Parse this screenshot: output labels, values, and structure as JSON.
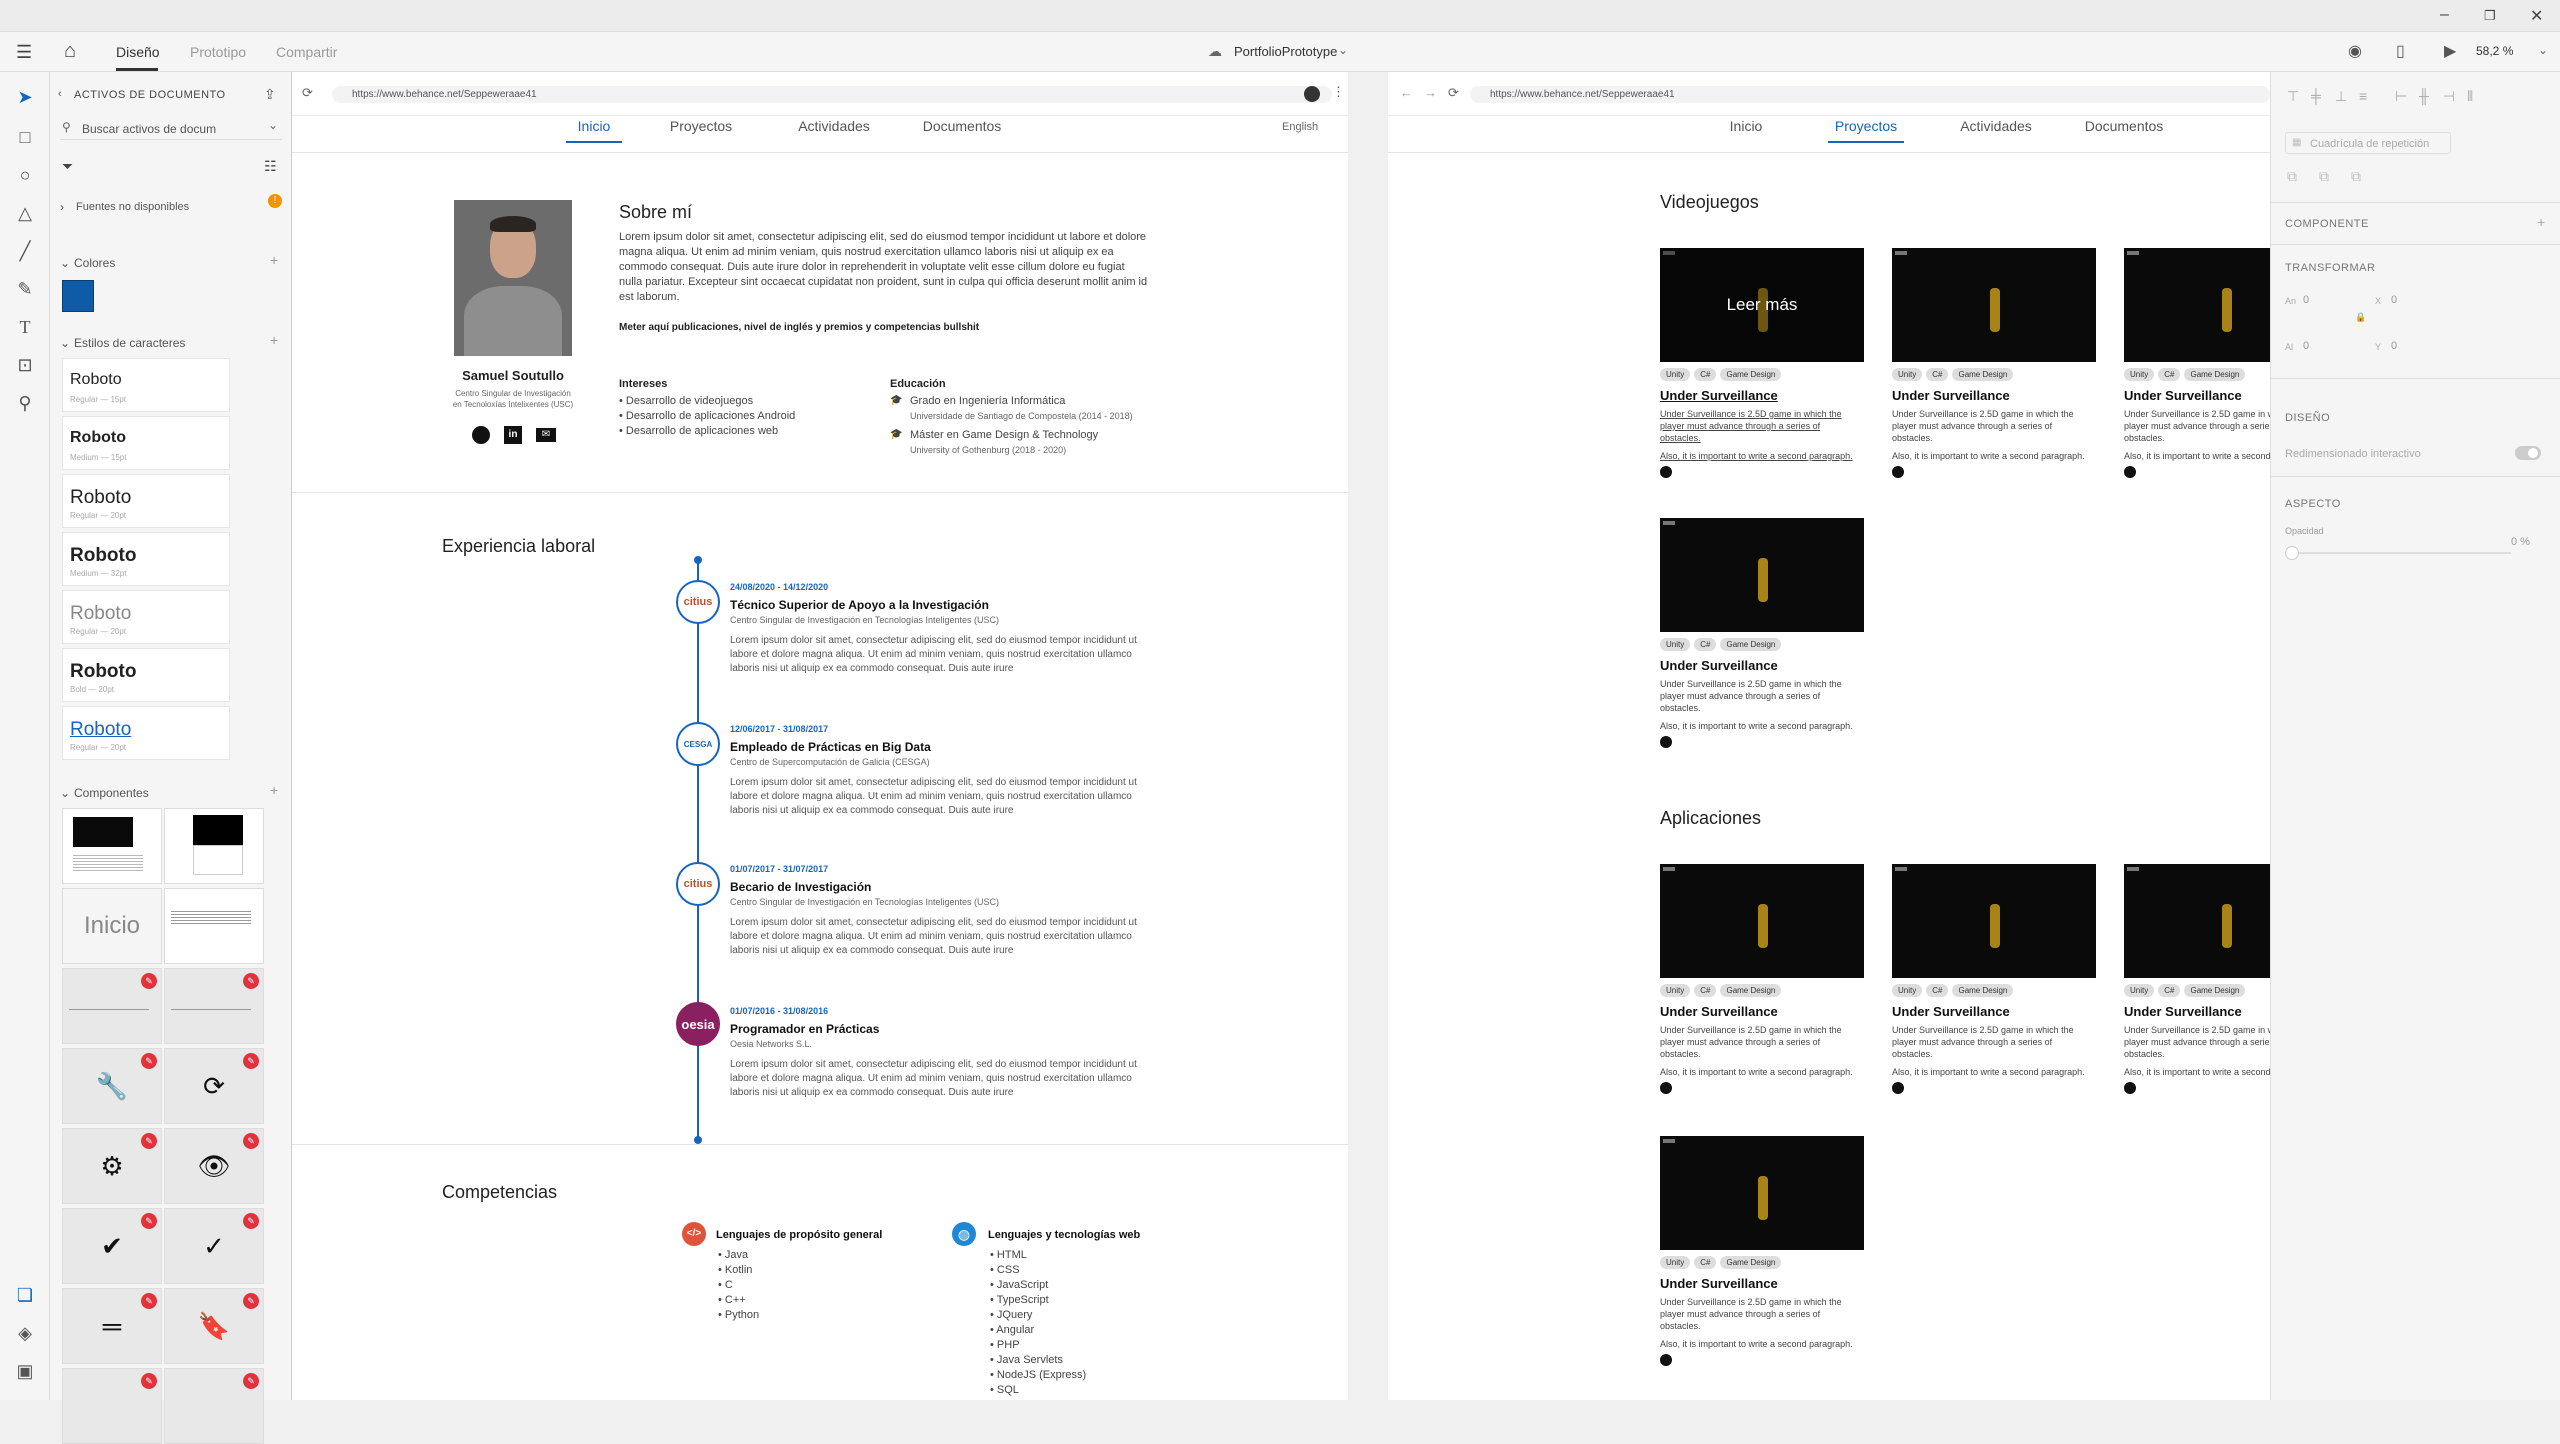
{
  "window": {
    "doc_title": "PortfolioPrototype",
    "zoom": "58,2 %"
  },
  "menubar": {
    "tabs": [
      "Diseño",
      "Prototipo",
      "Compartir"
    ]
  },
  "leftpanel": {
    "header": "ACTIVOS DE DOCUMENTO",
    "search_placeholder": "Buscar activos de docum",
    "fonts_missing": "Fuentes no disponibles",
    "colors_label": "Colores",
    "char_styles_label": "Estilos de caracteres",
    "char_styles": [
      {
        "name": "Roboto",
        "meta": "Regular — 15pt"
      },
      {
        "name": "Roboto",
        "meta": "Medium — 15pt"
      },
      {
        "name": "Roboto",
        "meta": "Regular — 20pt"
      },
      {
        "name": "Roboto",
        "meta": "Medium — 32pt"
      },
      {
        "name": "Roboto",
        "meta": "Regular — 20pt"
      },
      {
        "name": "Roboto",
        "meta": "Bold — 20pt"
      },
      {
        "name": "Roboto",
        "meta": "Regular — 20pt"
      }
    ],
    "components_label": "Componentes",
    "component_inicio": "Inicio"
  },
  "artboard1": {
    "url": "https://www.behance.net/Seppeweraae41",
    "tabs": [
      "Inicio",
      "Proyectos",
      "Actividades",
      "Documentos"
    ],
    "lang": "English",
    "profile": {
      "name": "Samuel Soutullo",
      "org1": "Centro Singular de Investigación",
      "org2": "en Tecnoloxías Intelixentes (USC)"
    },
    "about": {
      "title": "Sobre mí",
      "text": "Lorem ipsum dolor sit amet, consectetur adipiscing elit, sed do eiusmod tempor incididunt ut labore et dolore magna aliqua. Ut enim ad minim veniam, quis nostrud exercitation ullamco laboris nisi ut aliquip ex ea commodo consequat. Duis aute irure dolor in reprehenderit in voluptate velit esse cillum dolore eu fugiat nulla pariatur. Excepteur sint occaecat cupidatat non proident, sunt in culpa qui officia deserunt mollit anim id est laborum.",
      "note": "Meter aquí publicaciones, nivel de inglés y premios y competencias bullshit"
    },
    "interests": {
      "title": "Intereses",
      "items": [
        "• Desarrollo de videojuegos",
        "• Desarrollo de aplicaciones Android",
        "• Desarrollo de aplicaciones web"
      ]
    },
    "education": {
      "title": "Educación",
      "items": [
        {
          "t": "Grado en Ingeniería Informática",
          "s": "Universidade de Santiago de Compostela (2014 - 2018)"
        },
        {
          "t": "Máster en Game Design & Technology",
          "s": "University of Gothenburg (2018 - 2020)"
        }
      ]
    },
    "experience_title": "Experiencia laboral",
    "jobs": [
      {
        "logo": "citius",
        "date": "24/08/2020 - 14/12/2020",
        "title": "Técnico Superior de Apoyo a la Investigación",
        "org": "Centro Singular de Investigación en Tecnologías Inteligentes (USC)",
        "text": "Lorem ipsum dolor sit amet, consectetur adipiscing elit, sed do eiusmod tempor incididunt ut labore et dolore magna aliqua. Ut enim ad minim veniam, quis nostrud exercitation ullamco laboris nisi ut aliquip ex ea commodo consequat. Duis aute irure"
      },
      {
        "logo": "CESGA",
        "date": "12/06/2017 - 31/08/2017",
        "title": "Empleado de Prácticas en Big Data",
        "org": "Centro de Supercomputación de Galicia (CESGA)",
        "text": "Lorem ipsum dolor sit amet, consectetur adipiscing elit, sed do eiusmod tempor incididunt ut labore et dolore magna aliqua. Ut enim ad minim veniam, quis nostrud exercitation ullamco laboris nisi ut aliquip ex ea commodo consequat. Duis aute irure"
      },
      {
        "logo": "citius",
        "date": "01/07/2017 - 31/07/2017",
        "title": "Becario de Investigación",
        "org": "Centro Singular de Investigación en Tecnologías Inteligentes (USC)",
        "text": "Lorem ipsum dolor sit amet, consectetur adipiscing elit, sed do eiusmod tempor incididunt ut labore et dolore magna aliqua. Ut enim ad minim veniam, quis nostrud exercitation ullamco laboris nisi ut aliquip ex ea commodo consequat. Duis aute irure"
      },
      {
        "logo": "oesia",
        "date": "01/07/2016 - 31/08/2016",
        "title": "Programador en Prácticas",
        "org": "Oesia Networks S.L.",
        "text": "Lorem ipsum dolor sit amet, consectetur adipiscing elit, sed do eiusmod tempor incididunt ut labore et dolore magna aliqua. Ut enim ad minim veniam, quis nostrud exercitation ullamco laboris nisi ut aliquip ex ea commodo consequat. Duis aute irure"
      }
    ],
    "skills": {
      "title": "Competencias",
      "general": {
        "title": "Lenguajes de propósito general",
        "items": [
          "• Java",
          "• Kotlin",
          "• C",
          "• C++",
          "• Python"
        ]
      },
      "web": {
        "title": "Lenguajes y tecnologías web",
        "items": [
          "• HTML",
          "• CSS",
          "• JavaScript",
          "• TypeScript",
          "• JQuery",
          "• Angular",
          "• PHP",
          "• Java Servlets",
          "• NodeJS (Express)",
          "• SQL"
        ]
      }
    }
  },
  "artboard2": {
    "url": "https://www.behance.net/Seppeweraae41",
    "tabs": [
      "Inicio",
      "Proyectos",
      "Actividades",
      "Documentos"
    ],
    "section_games": "Videojuegos",
    "section_apps": "Aplicaciones",
    "hover_label": "Leer más",
    "card": {
      "tags": [
        "Unity",
        "C#",
        "Game Design"
      ],
      "title": "Under Surveillance",
      "desc": "Under Surveillance is 2.5D game in which the player must advance through a series of obstacles.",
      "desc2": "Also, it is important to write a second paragraph."
    }
  },
  "rightpanel": {
    "grid_label": "Cuadrícula de repetición",
    "component": "COMPONENTE",
    "transform": "TRANSFORMAR",
    "w_label": "An",
    "w": "0",
    "h_label": "Al",
    "h": "0",
    "x_label": "X",
    "x": "0",
    "y_label": "Y",
    "y": "0",
    "design": "DISEÑO",
    "responsive": "Redimensionado interactivo",
    "appearance": "ASPECTO",
    "opacity_label": "Opacidad",
    "opacity": "0 %"
  }
}
